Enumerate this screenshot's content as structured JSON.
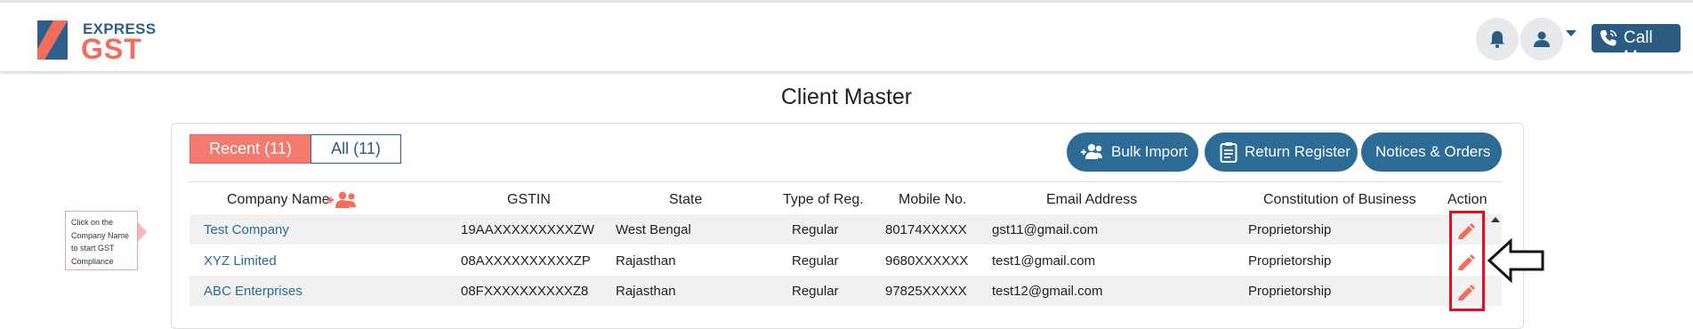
{
  "brand": {
    "line1": "EXPRESS",
    "line2": "GST"
  },
  "header": {
    "call_label": "Call Me"
  },
  "page": {
    "title": "Client Master"
  },
  "tabs": [
    {
      "label": "Recent (11)",
      "active": true
    },
    {
      "label": "All (11)",
      "active": false
    }
  ],
  "actions": {
    "bulk_import": "Bulk Import",
    "return_register": "Return Register",
    "notices_orders": "Notices & Orders"
  },
  "table": {
    "columns": [
      "Company Name",
      "GSTIN",
      "State",
      "Type of Reg.",
      "Mobile No.",
      "Email Address",
      "Constitution of Business",
      "Action"
    ],
    "rows": [
      {
        "company": "Test Company",
        "gstin": "19AAXXXXXXXXXZW",
        "state": "West Bengal",
        "reg": "Regular",
        "mobile": "80174XXXXX",
        "email": "gst11@gmail.com",
        "constitution": "Proprietorship"
      },
      {
        "company": "XYZ Limited",
        "gstin": "08AXXXXXXXXXXZP",
        "state": "Rajasthan",
        "reg": "Regular",
        "mobile": "9680XXXXXX",
        "email": "test1@gmail.com",
        "constitution": "Proprietorship"
      },
      {
        "company": "ABC Enterprises",
        "gstin": "08FXXXXXXXXXXZ8",
        "state": "Rajasthan",
        "reg": "Regular",
        "mobile": "97825XXXXX",
        "email": "test12@gmail.com",
        "constitution": "Proprietorship"
      }
    ]
  },
  "tooltip": {
    "text": "Click on the Company Name to start GST Compliance"
  },
  "colors": {
    "primary": "#2b6b96",
    "accent": "#f47a6f",
    "highlight": "#e2101f"
  },
  "icons": [
    "bell-icon",
    "user-icon",
    "phone-icon",
    "add-users-icon",
    "bulk-import-icon",
    "clipboard-icon",
    "edit-icon",
    "arrow-left-icon"
  ]
}
